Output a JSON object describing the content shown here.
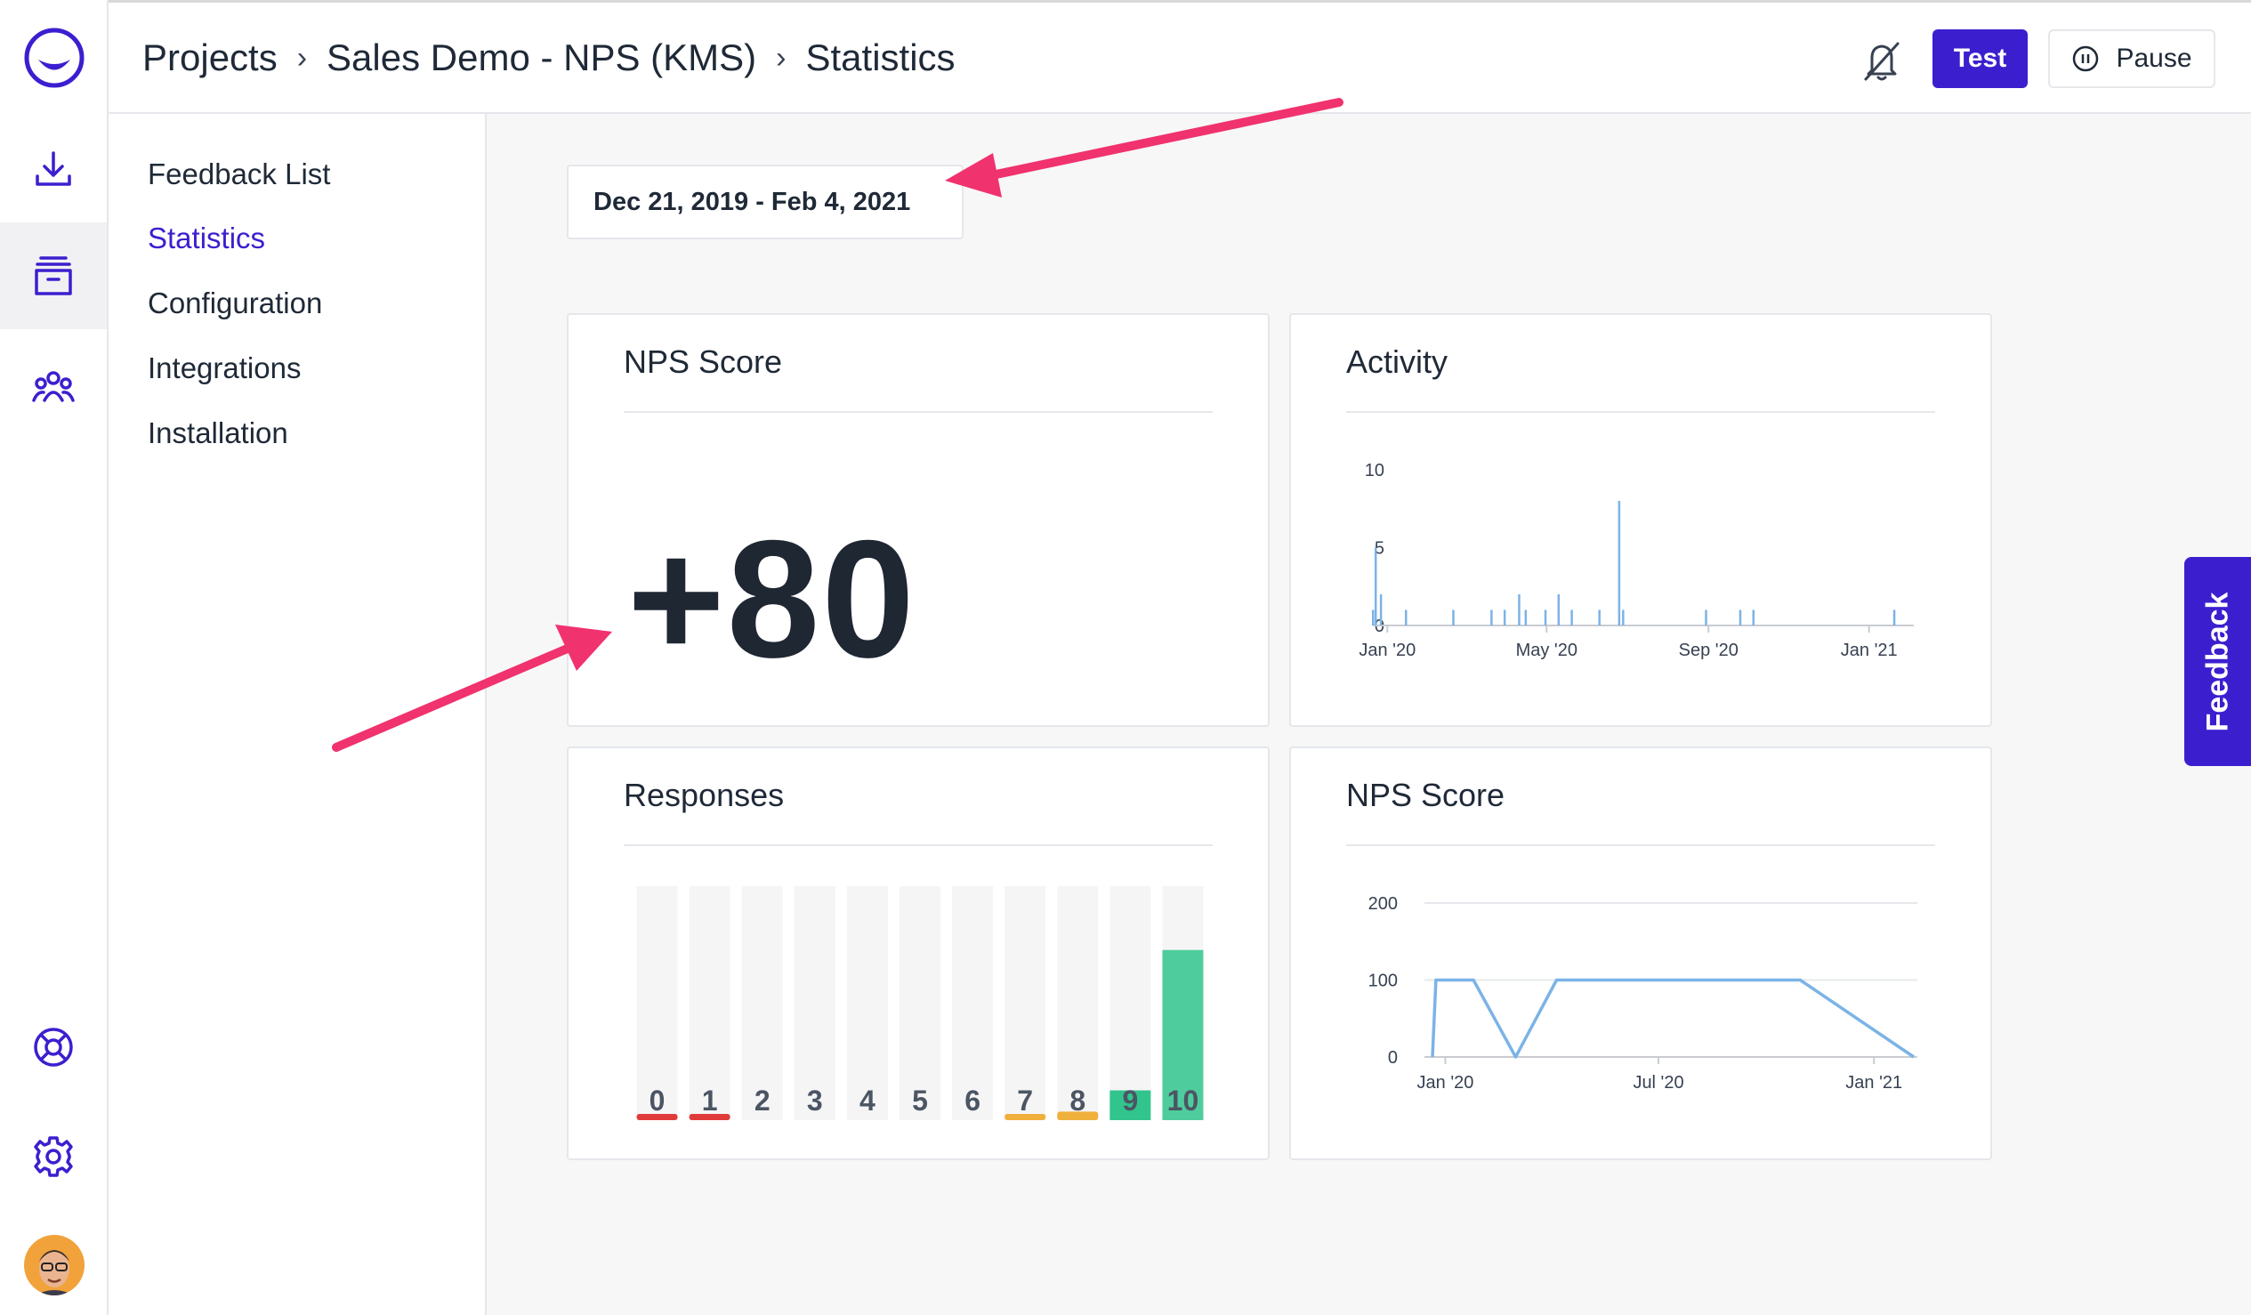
{
  "header": {
    "breadcrumbs": [
      "Projects",
      "Sales Demo - NPS (KMS)",
      "Statistics"
    ],
    "test_label": "Test",
    "pause_label": "Pause"
  },
  "subnav": {
    "items": [
      {
        "label": "Feedback List",
        "active": false
      },
      {
        "label": "Statistics",
        "active": true
      },
      {
        "label": "Configuration",
        "active": false
      },
      {
        "label": "Integrations",
        "active": false
      },
      {
        "label": "Installation",
        "active": false
      }
    ]
  },
  "rail": {
    "icons": [
      "logo-icon",
      "download-icon",
      "inbox-icon",
      "team-icon",
      "help-lifebuoy-icon",
      "settings-gear-icon",
      "user-avatar"
    ],
    "active": "inbox-icon"
  },
  "date_range": "Dec 21, 2019 - Feb 4, 2021",
  "cards": {
    "nps_score_title": "NPS Score",
    "nps_score_value": "+80",
    "activity_title": "Activity",
    "responses_title": "Responses",
    "nps_trend_title": "NPS Score"
  },
  "feedback_tab_label": "Feedback",
  "colors": {
    "accent": "#3b1fcf",
    "annotation_arrow": "#f0326e",
    "line": "#7bb3e6",
    "detractor": "#e03b3b",
    "passive": "#f0b03c",
    "promoter": "#31c48d"
  },
  "chart_data": [
    {
      "type": "bar",
      "name": "activity",
      "x_tick_labels": [
        "Jan '20",
        "May '20",
        "Sep '20",
        "Jan '21"
      ],
      "y_ticks": [
        0,
        5,
        10
      ],
      "ylim": [
        0,
        10
      ],
      "x": [
        "2019-12-21",
        "2019-12-23",
        "2019-12-27",
        "2020-01-15",
        "2020-02-20",
        "2020-03-20",
        "2020-03-30",
        "2020-04-10",
        "2020-04-15",
        "2020-04-30",
        "2020-05-10",
        "2020-05-20",
        "2020-06-10",
        "2020-06-25",
        "2020-06-28",
        "2020-08-30",
        "2020-09-25",
        "2020-10-05",
        "2021-01-20"
      ],
      "values": [
        1,
        5,
        2,
        1,
        1,
        1,
        1,
        2,
        1,
        1,
        2,
        1,
        1,
        8,
        1,
        1,
        1,
        1,
        1
      ]
    },
    {
      "type": "bar",
      "name": "responses",
      "categories": [
        "0",
        "1",
        "2",
        "3",
        "4",
        "5",
        "6",
        "7",
        "8",
        "9",
        "10"
      ],
      "values": [
        1,
        1,
        0,
        0,
        0,
        0,
        0,
        1,
        2,
        7,
        40
      ],
      "max": 55
    },
    {
      "type": "line",
      "name": "nps_over_time",
      "x_tick_labels": [
        "Jan '20",
        "Jul '20",
        "Jan '21"
      ],
      "y_ticks": [
        0,
        100,
        200
      ],
      "ylim": [
        0,
        200
      ],
      "x": [
        "2019-12-21",
        "2019-12-24",
        "2020-01-25",
        "2020-03-01",
        "2020-04-05",
        "2020-10-30",
        "2021-02-04"
      ],
      "y": [
        0,
        100,
        100,
        0,
        100,
        100,
        0
      ]
    }
  ]
}
